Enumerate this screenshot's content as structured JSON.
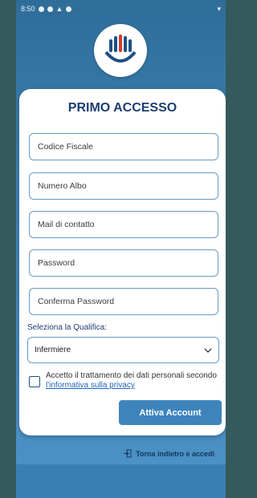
{
  "status_bar": {
    "time": "8:50",
    "signal": "▾"
  },
  "title": "PRIMO ACCESSO",
  "fields": {
    "codice_fiscale": "Codice Fiscale",
    "numero_albo": "Numero Albo",
    "mail": "Mail di contatto",
    "password": "Password",
    "conferma_password": "Conferma Password"
  },
  "qualifica": {
    "label": "Seleziona la Qualifica:",
    "selected": "Infermiere"
  },
  "consent": {
    "text": "Accetto il trattamento dei dati personali secondo ",
    "link": "l'informativa sulla privacy"
  },
  "activate_button": "Attiva Account",
  "back_link": "Torna indietro e accedi",
  "colors": {
    "accent": "#3d84bd",
    "title": "#1d3e72"
  }
}
